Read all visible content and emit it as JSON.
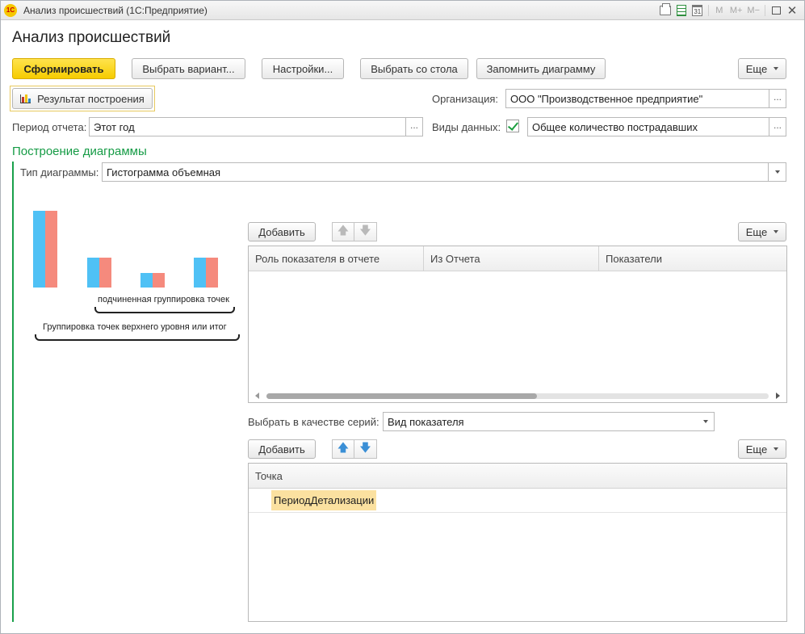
{
  "window": {
    "title": "Анализ происшествий  (1С:Предприятие)",
    "logo": "1С"
  },
  "title_tools": {
    "calendar_day": "31",
    "m": "M",
    "m_plus": "M+",
    "m_minus": "M−"
  },
  "page_title": "Анализ происшествий",
  "toolbar": {
    "generate": "Сформировать",
    "choose_variant": "Выбрать вариант...",
    "settings": "Настройки...",
    "choose_from_desk": "Выбрать со стола",
    "remember_chart": "Запомнить диаграмму",
    "more": "Еще"
  },
  "result_button": "Результат построения",
  "filters": {
    "org_label": "Организация:",
    "org_value": "ООО \"Производственное предприятие\"",
    "period_label": "Период отчета:",
    "period_value": "Этот год",
    "data_types_label": "Виды данных:",
    "data_types_checked": true,
    "data_types_value": "Общее количество пострадавших",
    "select_ellipsis": "..."
  },
  "chart_section": {
    "title": "Построение диаграммы",
    "type_label": "Тип диаграммы:",
    "type_value": "Гистограмма объемная"
  },
  "preview": {
    "inner_label": "подчиненная группировка точек",
    "outer_label": "Группировка точек верхнего уровня или итог",
    "colors": {
      "series_a": "#4fc1f5",
      "series_b": "#f58a7d"
    },
    "bars": [
      {
        "a": 1.0,
        "b": 1.0
      },
      {
        "a": 0.39,
        "b": 0.39
      },
      {
        "a": 0.19,
        "b": 0.19
      },
      {
        "a": 0.39,
        "b": 0.39
      }
    ]
  },
  "indicators": {
    "add": "Добавить",
    "more": "Еще",
    "columns": [
      "Роль показателя в отчете",
      "Из Отчета",
      "Показатели"
    ]
  },
  "series": {
    "label": "Выбрать в качестве серий:",
    "value": "Вид показателя"
  },
  "points": {
    "add": "Добавить",
    "more": "Еще",
    "column": "Точка",
    "rows": [
      "ПериодДетализации"
    ]
  },
  "accent": {
    "green": "#19a04a",
    "yellow": "#f6cc00",
    "selection": "#fbe1a0"
  }
}
